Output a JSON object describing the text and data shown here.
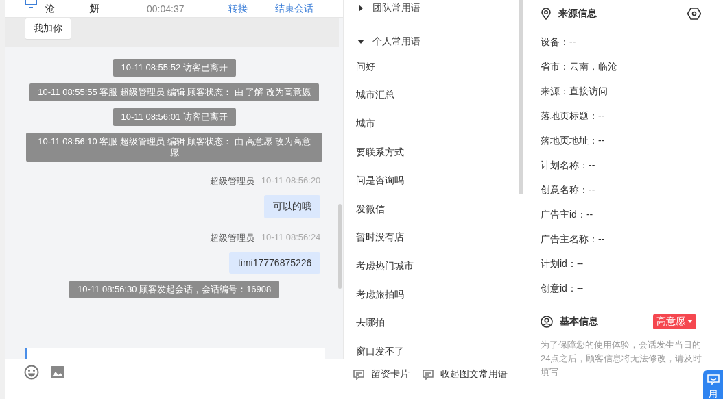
{
  "header": {
    "visitor": "沧",
    "agent": "妍",
    "duration": "00:04:37",
    "actions": [
      "转接",
      "结束会话"
    ]
  },
  "chat": {
    "messages": [
      {
        "kind": "visitor",
        "text": "我加你",
        "highlighted": true
      },
      {
        "kind": "system",
        "text": "10-11 08:55:52 访客已离开"
      },
      {
        "kind": "system",
        "text": "10-11 08:55:55 客服 超级管理员 编辑 顾客状态： 由 了解 改为高意愿"
      },
      {
        "kind": "system",
        "text": "10-11 08:56:01 访客已离开"
      },
      {
        "kind": "system",
        "text": "10-11 08:56:10 客服 超级管理员 编辑 顾客状态： 由 高意愿 改为高意愿"
      },
      {
        "kind": "agent",
        "sender": "超级管理员",
        "time": "10-11 08:56:20",
        "text": "可以的哦"
      },
      {
        "kind": "agent",
        "sender": "超级管理员",
        "time": "10-11 08:56:24",
        "text": "timi17776875226"
      },
      {
        "kind": "system",
        "text": "10-11 08:56:30 顾客发起会话，会话编号：16908"
      }
    ]
  },
  "phrases": {
    "groups": [
      {
        "label": "团队常用语",
        "expanded": false
      },
      {
        "label": "个人常用语",
        "expanded": true,
        "items": [
          "问好",
          "城市汇总",
          "城市",
          "要联系方式",
          "问是咨询吗",
          "发微信",
          "暂时没有店",
          "考虑热门城市",
          "考虑旅拍吗",
          "去哪拍",
          "窗口发不了"
        ]
      }
    ]
  },
  "toolbar": {
    "tools": [
      "留资卡片",
      "收起图文常用语"
    ]
  },
  "source_info": {
    "title": "来源信息",
    "fields": [
      "设备：--",
      "省市：云南，临沧",
      "来源：直接访问",
      "落地页标题：--",
      "落地页地址：--",
      "计划名称：--",
      "创意名称：--",
      "广告主id：--",
      "广告主名称：--",
      "计划id：--",
      "创意id：--"
    ]
  },
  "basic_info": {
    "title": "基本信息",
    "status": "高意愿",
    "notice": "为了保障您的使用体验，会话发生当日的24点之后，顾客信息将无法修改，请及时填写"
  },
  "float_button": {
    "label": "用"
  }
}
